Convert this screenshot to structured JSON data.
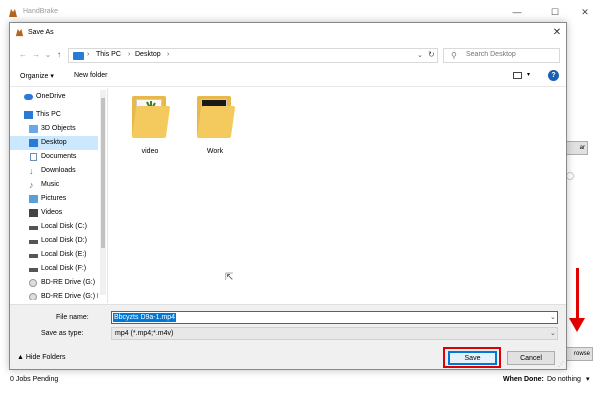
{
  "background_window": {
    "title": "HandBrake",
    "controls": {
      "minimize": "—",
      "maximize": "☐",
      "close": "✕"
    },
    "jobs_pending": "0 Jobs Pending",
    "when_done_label": "When Done:",
    "when_done_value": "Do nothing",
    "partial_button_top": "ar",
    "partial_button_bottom": "rowse"
  },
  "dialog": {
    "title": "Save As",
    "close_glyph": "✕",
    "nav": {
      "back": "←",
      "forward": "→",
      "recent": "⌄",
      "up": "↑"
    },
    "breadcrumb": [
      "This PC",
      "Desktop"
    ],
    "search": {
      "placeholder": "Search Desktop"
    },
    "toolbar": {
      "organize": "Organize ▾",
      "new_folder": "New folder",
      "help": "?"
    },
    "sidebar_items": [
      {
        "label": "OneDrive",
        "icon": "cloud-icon"
      },
      {
        "label": "This PC",
        "icon": "computer-icon"
      },
      {
        "label": "3D Objects",
        "icon": "cube-icon"
      },
      {
        "label": "Desktop",
        "icon": "desktop-icon",
        "selected": true
      },
      {
        "label": "Documents",
        "icon": "document-icon"
      },
      {
        "label": "Downloads",
        "icon": "download-icon"
      },
      {
        "label": "Music",
        "icon": "music-icon"
      },
      {
        "label": "Pictures",
        "icon": "pictures-icon"
      },
      {
        "label": "Videos",
        "icon": "videos-icon"
      },
      {
        "label": "Local Disk (C:)",
        "icon": "drive-icon"
      },
      {
        "label": "Local Disk (D:)",
        "icon": "drive-icon"
      },
      {
        "label": "Local Disk (E:)",
        "icon": "drive-icon"
      },
      {
        "label": "Local Disk (F:)",
        "icon": "drive-icon"
      },
      {
        "label": "BD-RE Drive (G:)",
        "icon": "disc-drive-icon"
      },
      {
        "label": "BD-RE Drive (G:) D",
        "icon": "disc-drive-icon"
      }
    ],
    "folders": [
      {
        "label": "video"
      },
      {
        "label": "Work"
      }
    ],
    "file_name": {
      "label": "File name:",
      "value": "Bbcyzts D9a-1.mp4"
    },
    "save_as_type": {
      "label": "Save as type:",
      "value": "mp4 (*.mp4;*.m4v)"
    },
    "hide_folders": "▲  Hide Folders",
    "save_button": "Save",
    "cancel_button": "Cancel"
  },
  "colors": {
    "selection": "#cce8ff",
    "accent": "#0078d7",
    "highlight": "#e00000",
    "folder": "#f4c95d"
  }
}
